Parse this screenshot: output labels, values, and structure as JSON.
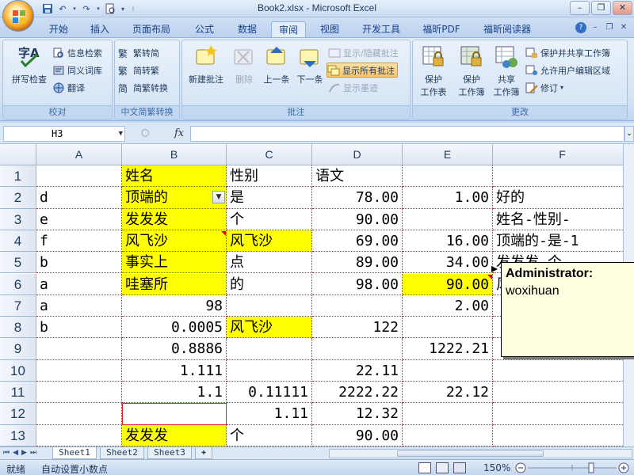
{
  "window": {
    "title": "Book2.xlsx - Microsoft Excel",
    "controls": {
      "minimize": "–",
      "restore": "❐",
      "close": "✕"
    }
  },
  "tabs": [
    "开始",
    "插入",
    "页面布局",
    "公式",
    "数据",
    "审阅",
    "视图",
    "开发工具",
    "福昕PDF",
    "福昕阅读器"
  ],
  "active_tab": "审阅",
  "ribbon": {
    "proofing": {
      "label": "校对",
      "spell_check": "拼写检查",
      "research": "信息检索",
      "thesaurus": "同义词库",
      "translate": "翻译"
    },
    "chinese_conversion": {
      "label": "中文简繁转换",
      "to_simplified": "繁转简",
      "to_traditional": "简转繁",
      "conversion": "简繁转换"
    },
    "comments": {
      "label": "批注",
      "new": "新建批注",
      "delete": "删除",
      "previous": "上一条",
      "next": "下一条",
      "show_hide": "显示/隐藏批注",
      "show_all": "显示所有批注",
      "show_ink": "显示墨迹"
    },
    "changes": {
      "label": "更改",
      "protect_sheet_1": "保护",
      "protect_sheet_2": "工作表",
      "protect_workbook_1": "保护",
      "protect_workbook_2": "工作簿",
      "share_1": "共享",
      "share_2": "工作簿",
      "protect_share": "保护并共享工作簿",
      "allow_edit": "允许用户编辑区域",
      "track": "修订"
    }
  },
  "formula_bar": {
    "name_box": "H3",
    "fx": "fx",
    "value": ""
  },
  "columns": [
    "A",
    "B",
    "C",
    "D",
    "E",
    "F"
  ],
  "rows": [
    "1",
    "2",
    "3",
    "4",
    "5",
    "6",
    "7",
    "8",
    "9",
    "10",
    "11",
    "12",
    "13"
  ],
  "cells": {
    "A2": "d",
    "A3": "e",
    "A4": "f",
    "A5": "b",
    "A6": "a",
    "A7": "a",
    "A8": "b",
    "B1": "姓名",
    "B2": "顶端的",
    "B3": "发发发",
    "B4": "风飞沙",
    "B5": "事实上",
    "B6": "哇塞所",
    "B7": "98",
    "B8": "0.0005",
    "B9": "0.8886",
    "B10": "1.111",
    "B11": "1.1",
    "B13": "发发发",
    "C1": "性别",
    "C2": "是",
    "C3": "个",
    "C4": "风飞沙",
    "C5": "点",
    "C6": "的",
    "C8": "风飞沙",
    "C11": "0.11111",
    "C12": "1.11",
    "C13": "个",
    "D1": "语文",
    "D2": "78.00",
    "D3": "90.00",
    "D4": "69.00",
    "D5": "89.00",
    "D6": "98.00",
    "D8": "122",
    "D10": "22.11",
    "D11": "2222.22",
    "D12": "12.32",
    "D13": "90.00",
    "E2": "1.00",
    "E4": "16.00",
    "E5": "34.00",
    "E6": "90.00",
    "E7": "2.00",
    "E9": "1222.21",
    "E11": "22.12",
    "F2": "好的",
    "F3": "姓名-性别-",
    "F4": "顶端的-是-1",
    "F5": "发发发-个",
    "F6": "风"
  },
  "comment": {
    "author": "Administrator:",
    "text": "woxihuan"
  },
  "sheets": [
    "Sheet1",
    "Sheet2",
    "Sheet3"
  ],
  "active_sheet": "Sheet1",
  "status": {
    "ready": "就绪",
    "auto_decimal": "自动设置小数点",
    "zoom": "150%"
  },
  "colors": {
    "highlight": "#ffff00",
    "comment_bg": "#ffffe1",
    "ribbon_bg": "#dbe7f6"
  }
}
